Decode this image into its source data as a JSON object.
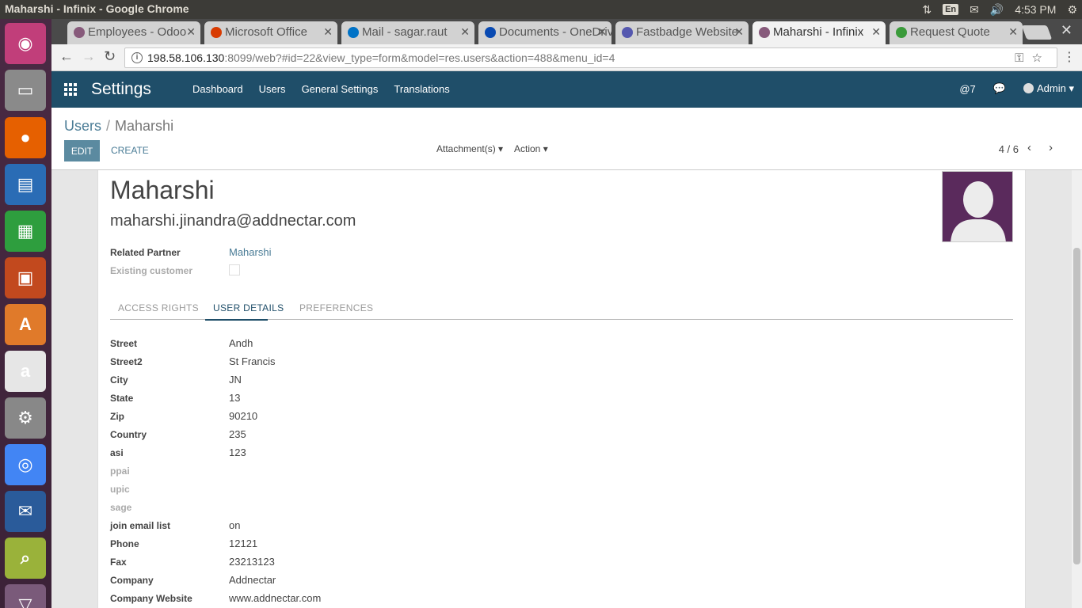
{
  "window": {
    "title": "Maharshi - Infinix - Google Chrome",
    "time": "4:53 PM",
    "keyboard": "En"
  },
  "launcher": [
    {
      "name": "ubuntu-dash-icon",
      "color": "#c13e7a",
      "glyph": "◉"
    },
    {
      "name": "files-icon",
      "color": "#8a8a8a",
      "glyph": "▭"
    },
    {
      "name": "firefox-icon",
      "color": "#e66000",
      "glyph": "●"
    },
    {
      "name": "writer-icon",
      "color": "#2a6cb5",
      "glyph": "▤"
    },
    {
      "name": "calc-icon",
      "color": "#2e9e3e",
      "glyph": "▦"
    },
    {
      "name": "impress-icon",
      "color": "#c2491e",
      "glyph": "▣"
    },
    {
      "name": "software-center-icon",
      "color": "#e07a2a",
      "glyph": "A"
    },
    {
      "name": "amazon-icon",
      "color": "#e6e6e6",
      "glyph": "a"
    },
    {
      "name": "system-settings-icon",
      "color": "#888888",
      "glyph": "⚙"
    },
    {
      "name": "chrome-icon",
      "color": "#4285f4",
      "glyph": "◎"
    },
    {
      "name": "thunderbird-icon",
      "color": "#2a5b9a",
      "glyph": "✉"
    },
    {
      "name": "screenshot-icon",
      "color": "#9ab23a",
      "glyph": "⌕"
    },
    {
      "name": "trash-icon",
      "color": "#7a5a7a",
      "glyph": "▽"
    }
  ],
  "tabs": [
    {
      "label": "Employees - Odoo",
      "color": "#875a7b",
      "active": false
    },
    {
      "label": "Microsoft Office",
      "color": "#d83b01",
      "active": false
    },
    {
      "label": "Mail - sagar.raut",
      "color": "#0072c6",
      "active": false
    },
    {
      "label": "Documents - OneDrive",
      "color": "#094ab2",
      "active": false
    },
    {
      "label": "Fastbadge Website",
      "color": "#5558af",
      "active": false
    },
    {
      "label": "Maharshi - Infinix",
      "color": "#875a7b",
      "active": true
    },
    {
      "label": "Request Quote",
      "color": "#3a9a3a",
      "active": false
    }
  ],
  "address": {
    "host": "198.58.106.130",
    "rest": ":8099/web?#id=22&view_type=form&model=res.users&action=488&menu_id=4"
  },
  "nav": {
    "brand": "Settings",
    "menu": [
      "Dashboard",
      "Users",
      "General Settings",
      "Translations"
    ],
    "mentions": "@7",
    "user": "Admin"
  },
  "breadcrumb": {
    "parent": "Users",
    "sep": "/",
    "current": "Maharshi"
  },
  "buttons": {
    "edit": "EDIT",
    "create": "CREATE",
    "attachments": "Attachment(s)",
    "action": "Action"
  },
  "pager": "4 / 6",
  "record": {
    "name": "Maharshi",
    "email": "maharshi.jinandra@addnectar.com",
    "related_partner_label": "Related Partner",
    "related_partner": "Maharshi",
    "existing_customer_label": "Existing customer"
  },
  "form_tabs": [
    "ACCESS RIGHTS",
    "USER DETAILS",
    "PREFERENCES"
  ],
  "details": [
    {
      "label": "Street",
      "value": "Andh",
      "muted": false
    },
    {
      "label": "Street2",
      "value": "St Francis",
      "muted": false
    },
    {
      "label": "City",
      "value": "JN",
      "muted": false
    },
    {
      "label": "State",
      "value": "13",
      "muted": false
    },
    {
      "label": "Zip",
      "value": "90210",
      "muted": false
    },
    {
      "label": "Country",
      "value": "235",
      "muted": false
    },
    {
      "label": "asi",
      "value": "123",
      "muted": false
    },
    {
      "label": "ppai",
      "value": "",
      "muted": true
    },
    {
      "label": "upic",
      "value": "",
      "muted": true
    },
    {
      "label": "sage",
      "value": "",
      "muted": true
    },
    {
      "label": "join email list",
      "value": "on",
      "muted": false
    },
    {
      "label": "Phone",
      "value": "12121",
      "muted": false
    },
    {
      "label": "Fax",
      "value": "23213123",
      "muted": false
    },
    {
      "label": "Company",
      "value": "Addnectar",
      "muted": false
    },
    {
      "label": "Company Website",
      "value": "www.addnectar.com",
      "muted": false
    }
  ]
}
